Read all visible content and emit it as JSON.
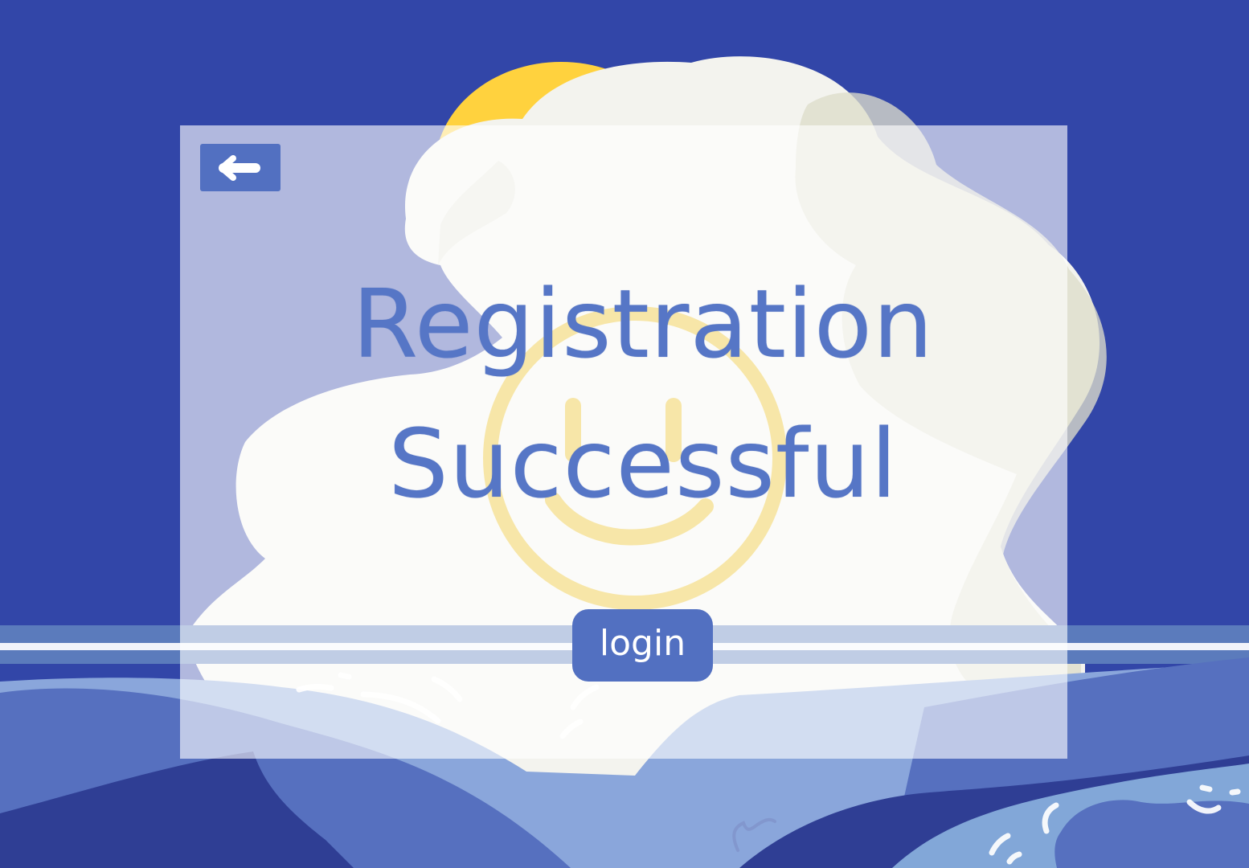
{
  "screen": {
    "heading_line_1": "Registration",
    "heading_line_2": "Successful",
    "login_label": "login",
    "back_icon": "arrow-left-icon"
  },
  "colors": {
    "sky": "#3246a8",
    "panel": "rgba(255,255,255,0.62)",
    "accent_button": "#5270c1",
    "heading_text": "#5676c6",
    "sun": "#ffd23e",
    "cloud": "#f5f5f0",
    "water": "#5670bf"
  }
}
